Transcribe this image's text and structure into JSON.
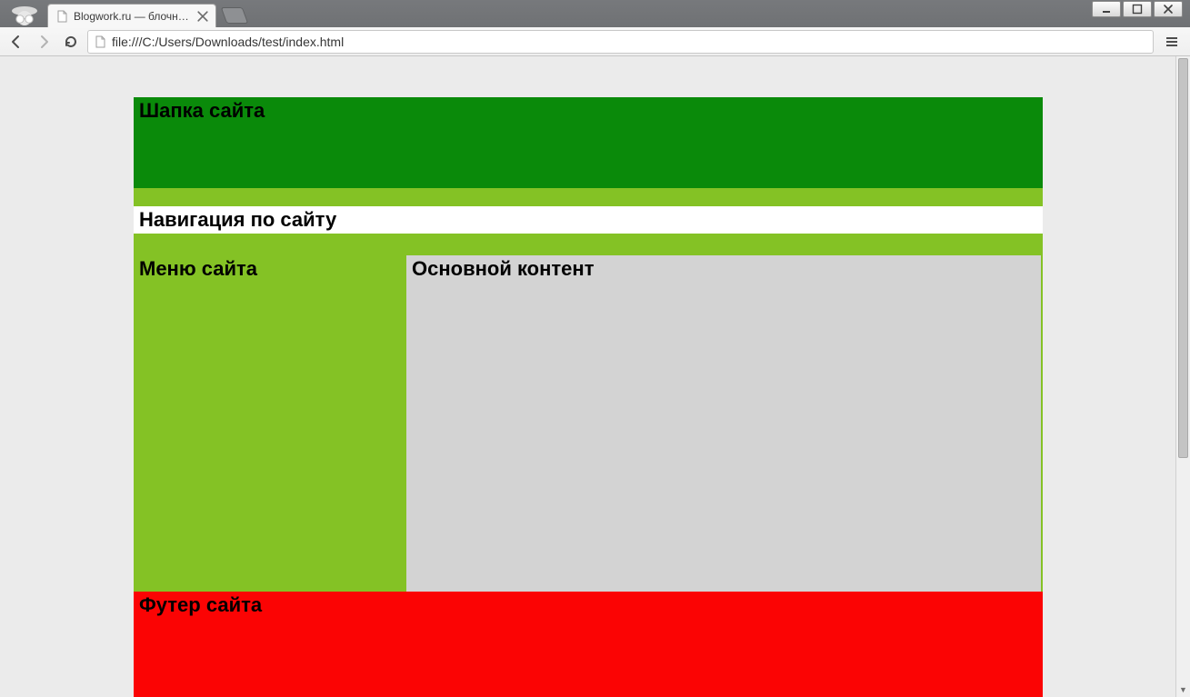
{
  "browser": {
    "tab_title": "Blogwork.ru — блочная вер",
    "url": "file:///C:/Users/Downloads/test/index.html"
  },
  "page": {
    "header_label": "Шапка сайта",
    "nav_label": "Навигация по сайту",
    "menu_label": "Меню сайта",
    "content_label": "Основной контент",
    "footer_label": "Футер сайта"
  }
}
